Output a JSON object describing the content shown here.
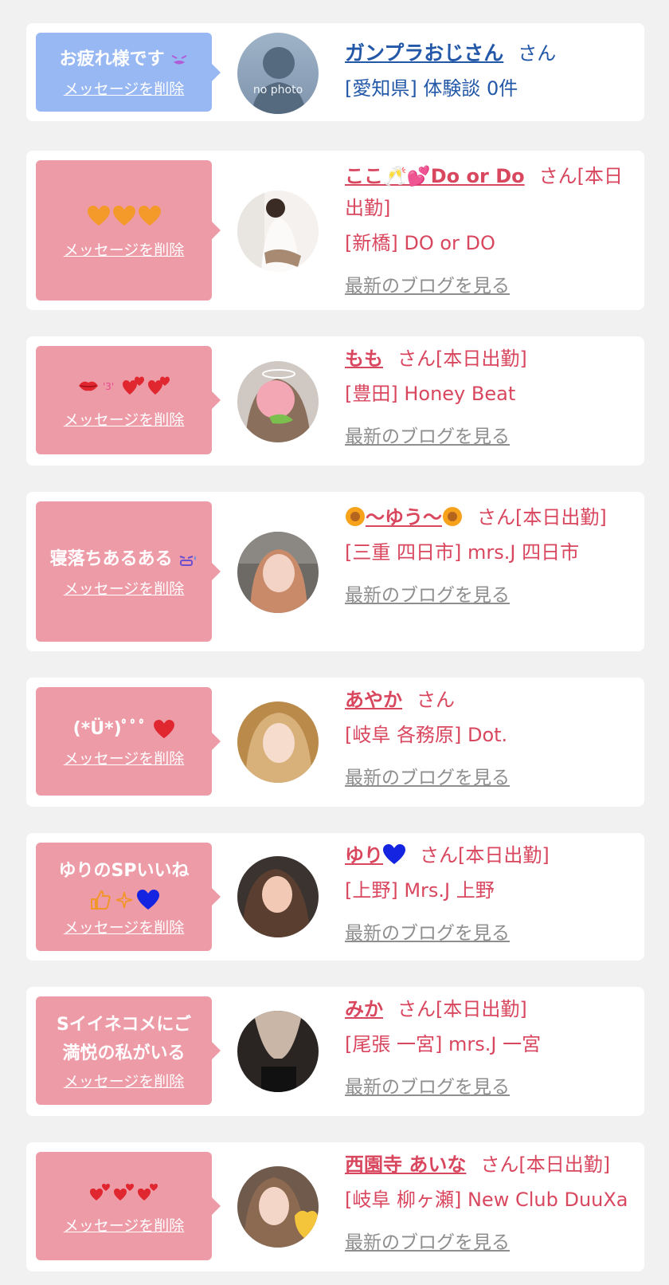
{
  "delete_label": "メッセージを削除",
  "blog_label": "最新のブログを見る",
  "colors": {
    "pink_bubble": "#ee9ba8",
    "blue_bubble": "#98b8f3",
    "name_pink": "#d9475f",
    "name_blue": "#2358a8",
    "blog_gray": "#8e8e8e"
  },
  "items": [
    {
      "message": "お疲れ様です",
      "name": "ガンプラおじさん",
      "san": "さん",
      "location": "[愛知県] 体験談 0件",
      "avatar_text": "no photo",
      "avatar_icon": "no-photo-silhouette-icon"
    },
    {
      "name": "ここ🥂💕Do or Do",
      "san": "さん[本日出勤]",
      "location": "[新橋] DO or DO",
      "emoji_icons": [
        "orange-heart-icon",
        "orange-heart-icon",
        "orange-heart-icon"
      ]
    },
    {
      "name": "もも",
      "san": "さん[本日出勤]",
      "location": "[豊田] Honey Beat",
      "emoji_icons": [
        "lips-icon",
        "kiss-face-icon",
        "two-hearts-icon",
        "two-hearts-icon"
      ]
    },
    {
      "message": "寝落ちあるある",
      "name": "〜ゆう〜",
      "name_icon": "sunflower-icon",
      "san": "さん[本日出勤]",
      "location": "[三重 四日市] mrs.J 四日市"
    },
    {
      "message": "(*Ü*)ﾟﾟﾟ",
      "name": "あやか",
      "san": "さん",
      "location": "[岐阜 各務原] Dot."
    },
    {
      "message": "ゆりのSPいいね",
      "name": "ゆり",
      "name_icon": "blue-heart-icon",
      "san": "さん[本日出勤]",
      "location": "[上野] Mrs.J 上野",
      "emoji_icons": [
        "thumbs-up-icon",
        "sparkles-icon",
        "blue-heart-icon"
      ]
    },
    {
      "message": "Sイイネコメにご満悦の私がいる",
      "name": "みか",
      "san": "さん[本日出勤]",
      "location": "[尾張 一宮] mrs.J 一宮"
    },
    {
      "name": "西園寺 あいな",
      "san": "さん[本日出勤]",
      "location": "[岐阜 柳ヶ瀬] New Club DuuXa",
      "emoji_icons": [
        "revolving-hearts-icon",
        "revolving-hearts-icon",
        "revolving-hearts-icon"
      ]
    }
  ]
}
